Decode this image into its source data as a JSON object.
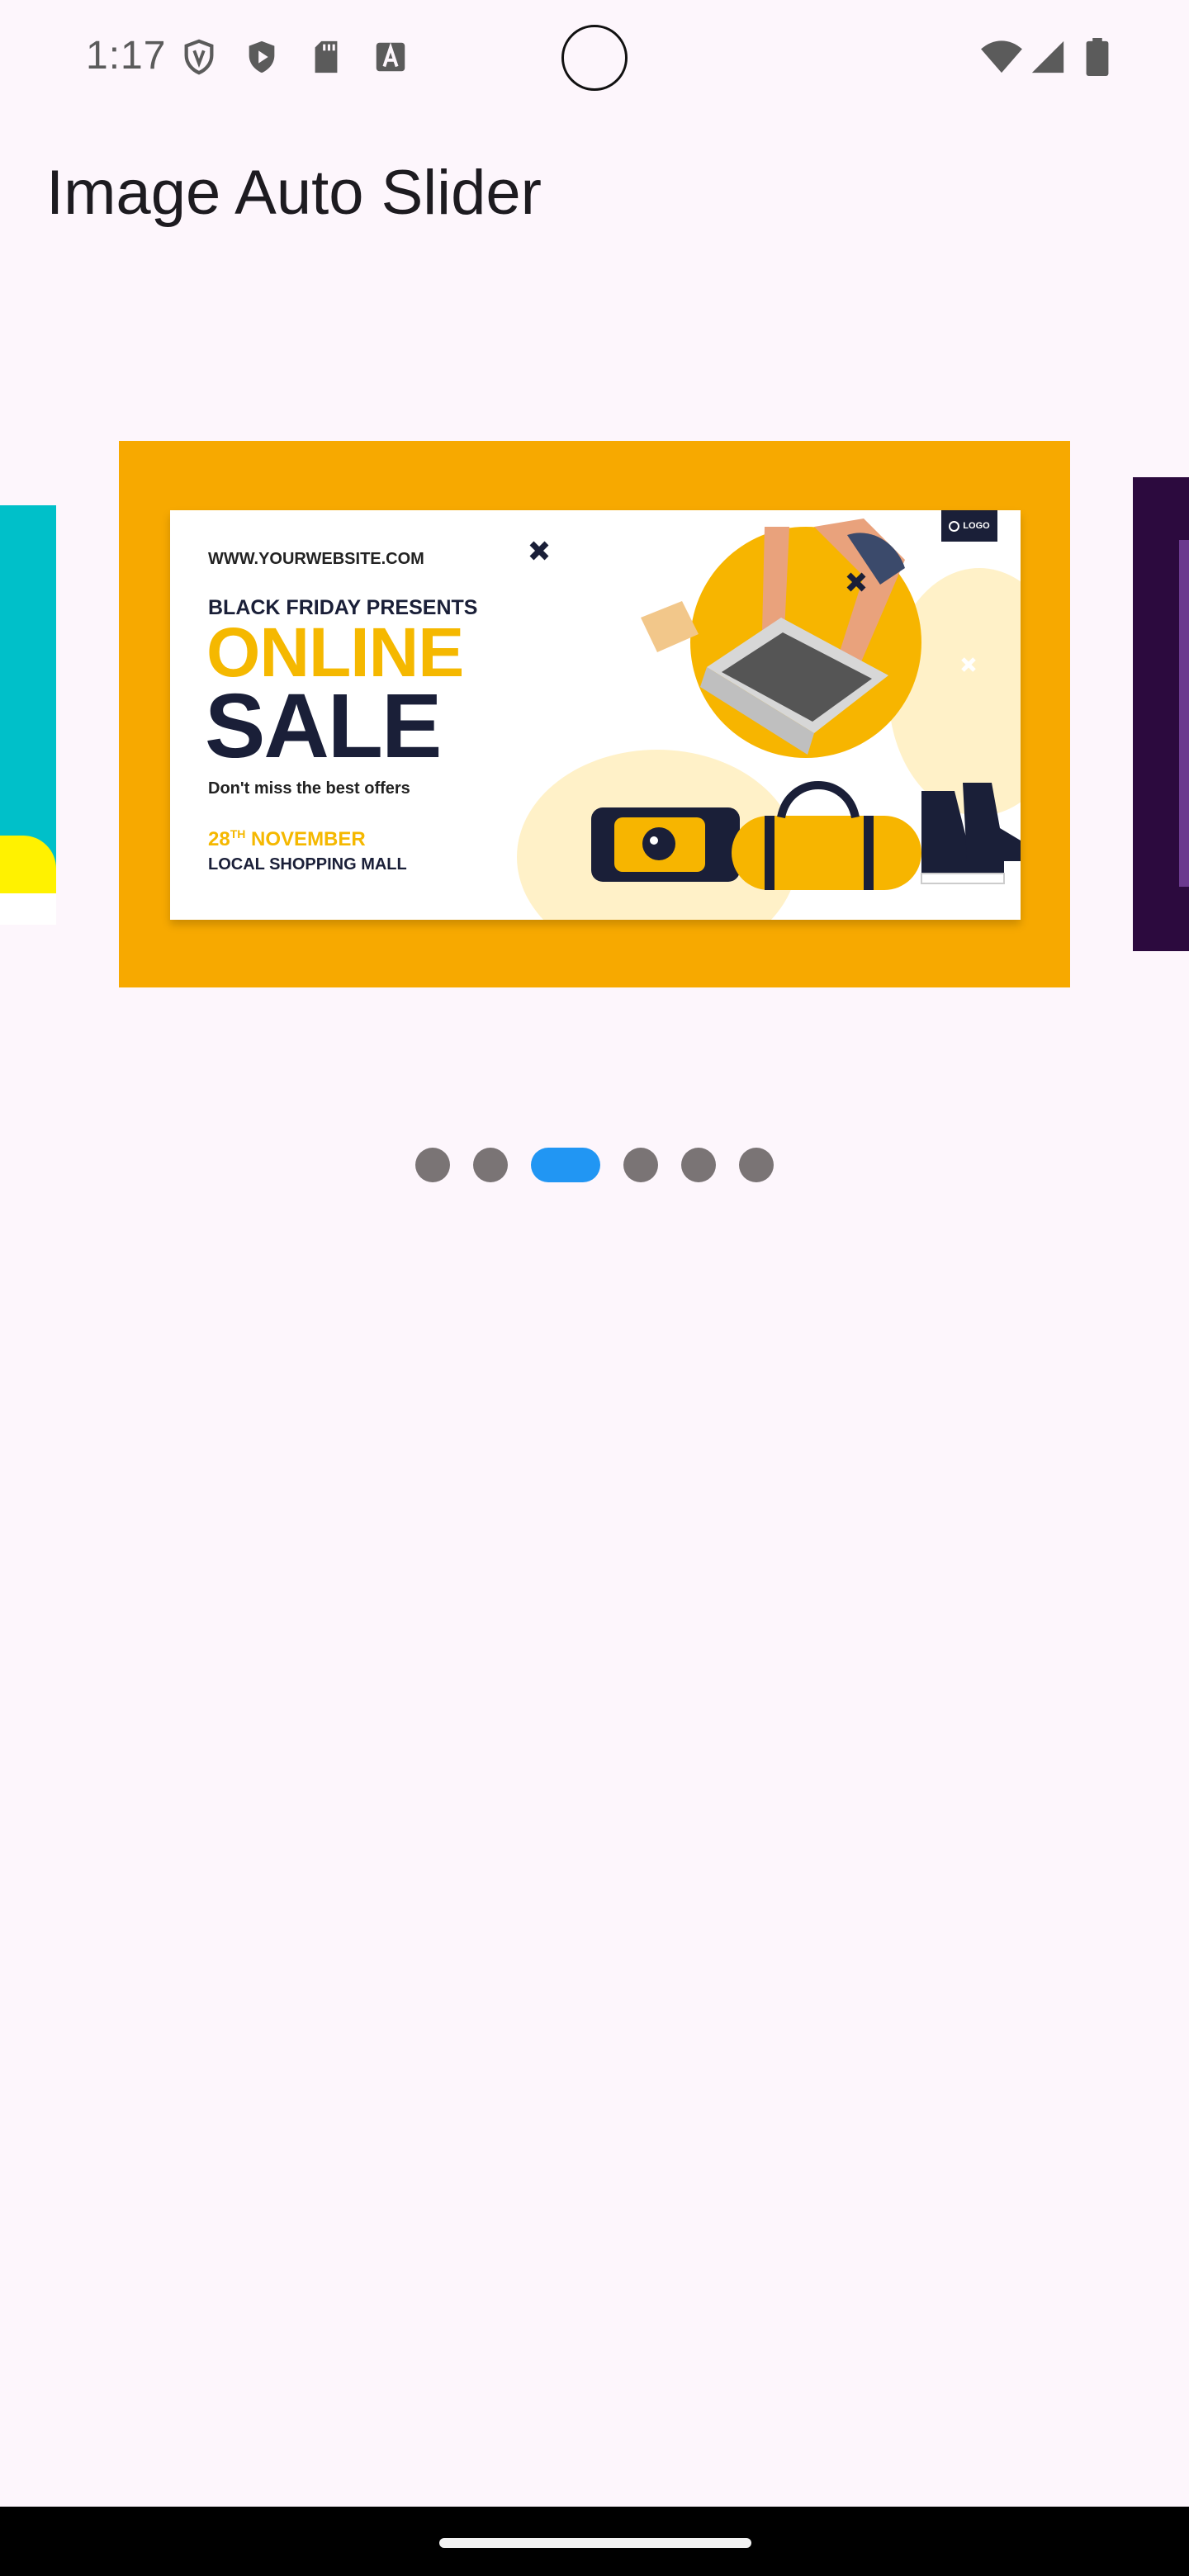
{
  "status_bar": {
    "time": "1:17",
    "left_icons": [
      "vpn-shield-icon",
      "play-protect-icon",
      "sd-card-icon",
      "font-a-icon"
    ],
    "right_icons": [
      "wifi-icon",
      "cellular-signal-icon",
      "battery-icon"
    ]
  },
  "app_bar": {
    "title": "Image Auto Slider"
  },
  "carousel": {
    "current_slide": {
      "website": "WWW.YOURWEBSITE.COM",
      "logo": "LOGO",
      "presents": "BLACK FRIDAY PRESENTS",
      "headline_1": "ONLINE",
      "headline_2": "SALE",
      "tagline": "Don't miss the best offers",
      "date_day": "28",
      "date_suffix": "TH",
      "date_month": "NOVEMBER",
      "location": "LOCAL SHOPPING  MALL"
    },
    "colors": {
      "frame": "#f7a900",
      "accent_yellow": "#f5b800",
      "navy": "#1a1f38",
      "prev_slide": "#00c0c9",
      "next_slide": "#2c0a3e"
    }
  },
  "indicator": {
    "count": 6,
    "active_index": 2,
    "active_color": "#2196f3",
    "inactive_color": "#7a7475"
  }
}
